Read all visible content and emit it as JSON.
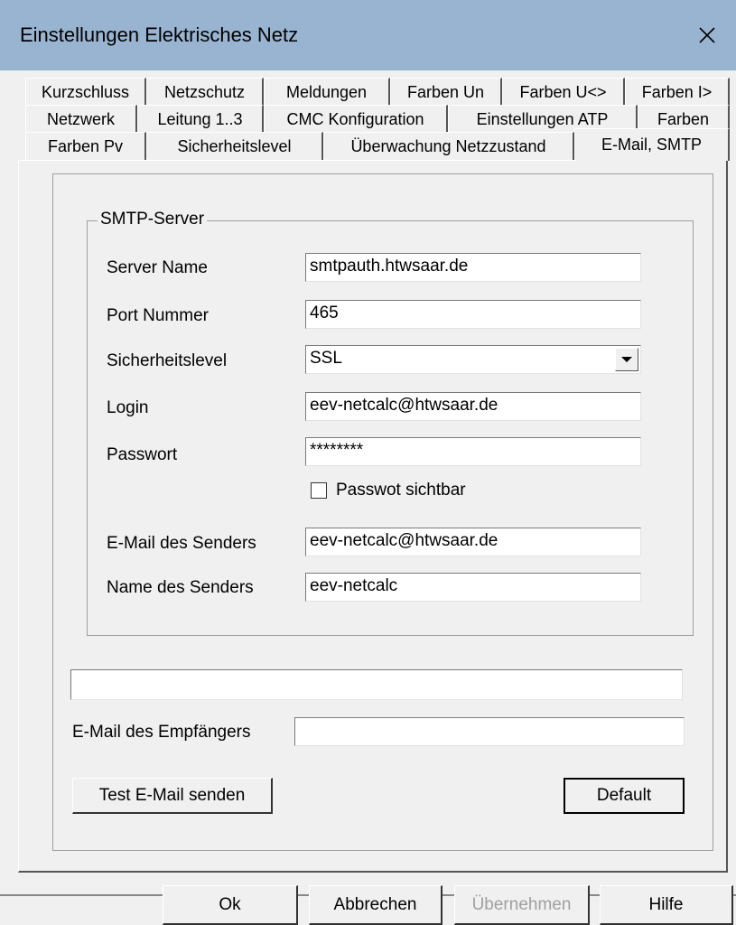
{
  "window": {
    "title": "Einstellungen Elektrisches Netz",
    "close_icon": "×"
  },
  "tabs": {
    "row1": [
      "Kurzschluss",
      "Netzschutz",
      "Meldungen",
      "Farben Un",
      "Farben U<>",
      "Farben I>"
    ],
    "row2": [
      "Netzwerk",
      "Leitung 1..3",
      "CMC Konfiguration",
      "Einstellungen ATP",
      "Farben"
    ],
    "row3": [
      "Farben Pv",
      "Sicherheitslevel",
      "Überwachung Netzzustand",
      "E-Mail, SMTP"
    ],
    "active": "E-Mail, SMTP"
  },
  "smtp": {
    "group_title": "SMTP-Server",
    "server_name_label": "Server Name",
    "server_name_value": "smtpauth.htwsaar.de",
    "port_label": "Port Nummer",
    "port_value": "465",
    "security_label": "Sicherheitslevel",
    "security_value": "SSL",
    "login_label": "Login",
    "login_value": "eev-netcalc@htwsaar.de",
    "password_label": "Passwort",
    "password_value": "********",
    "show_password_label": "Passwot sichtbar",
    "show_password_checked": false,
    "sender_email_label": "E-Mail des Senders",
    "sender_email_value": "eev-netcalc@htwsaar.de",
    "sender_name_label": "Name des Senders",
    "sender_name_value": "eev-netcalc"
  },
  "status_value": "",
  "recipient": {
    "label": "E-Mail des Empfängers",
    "value": ""
  },
  "panel_buttons": {
    "test_email": "Test E-Mail senden",
    "default": "Default"
  },
  "footer_buttons": {
    "ok": "Ok",
    "cancel": "Abbrechen",
    "apply": "Übernehmen",
    "help": "Hilfe"
  }
}
